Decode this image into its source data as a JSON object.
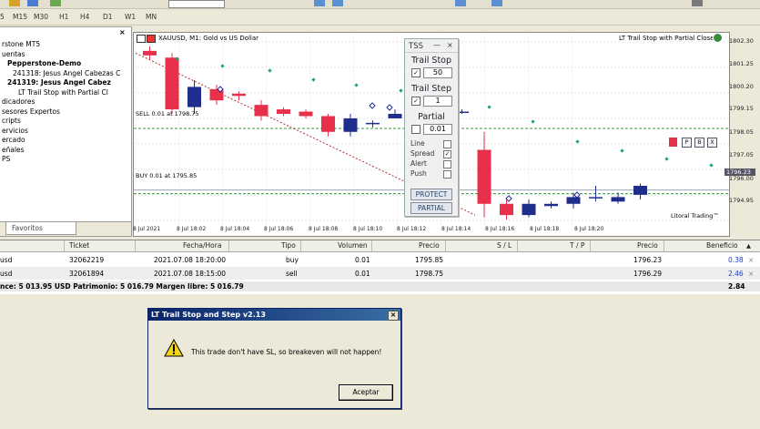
{
  "timeframes": [
    "5",
    "M15",
    "M30",
    "H1",
    "H4",
    "D1",
    "W1",
    "MN"
  ],
  "navigator": {
    "rows": [
      {
        "label": "rstone MT5",
        "bold": false
      },
      {
        "label": "uentas",
        "bold": false
      },
      {
        "label": "Pepperstone-Demo",
        "bold": true
      },
      {
        "label": "241318: Jesus Angel Cabezas C",
        "bold": false
      },
      {
        "label": "241319: Jesus Angel Cabez",
        "bold": true
      },
      {
        "label": "LT Trail Stop with Partial Cl",
        "bold": false
      },
      {
        "label": "dicadores",
        "bold": false
      },
      {
        "label": "sesores Expertos",
        "bold": false
      },
      {
        "label": "cripts",
        "bold": false
      },
      {
        "label": "ervicios",
        "bold": false
      },
      {
        "label": "ercado",
        "bold": false
      },
      {
        "label": "eñales",
        "bold": false
      },
      {
        "label": "PS",
        "bold": false
      }
    ],
    "close": "×",
    "favorites_tab": "Favoritos"
  },
  "chart": {
    "symbol_title": "XAUUSD, M1:  Gold vs US Dollar",
    "ea_title": "LT Trail Stop with Partial Close",
    "sell_line_label": "SELL 0.01 at 1798.75",
    "buy_line_label": "BUY 0.01 at 1795.85",
    "current_price": "1796.23",
    "watermark": "Litoral Trading™",
    "price_labels": [
      "1802.30",
      "1801.25",
      "1800.20",
      "1799.15",
      "1798.05",
      "1797.05",
      "1796.00",
      "1794.95"
    ],
    "time_labels": [
      "8 Jul 2021",
      "8 Jul 18:02",
      "8 Jul 18:04",
      "8 Jul 18:06",
      "8 Jul 18:08",
      "8 Jul 18:10",
      "8 Jul 18:12",
      "8 Jul 18:14",
      "8 Jul 18:16",
      "8 Jul 18:18",
      "8 Jul 18:20"
    ],
    "pbx": [
      "P",
      "B",
      "X"
    ]
  },
  "tss": {
    "title": "TSS",
    "minimize": "—",
    "close": "×",
    "trail_stop_label": "Trail Stop",
    "trail_stop_value": "50",
    "trail_step_label": "Trail Step",
    "trail_step_value": "1",
    "partial_label": "Partial",
    "partial_value": "0.01",
    "check": "✓",
    "opts": [
      {
        "label": "Line",
        "checked": false
      },
      {
        "label": "Spread",
        "checked": true
      },
      {
        "label": "Alert",
        "checked": false
      },
      {
        "label": "Push",
        "checked": false
      }
    ],
    "protect_btn": "PROTECT",
    "partial_btn": "PARTIAL"
  },
  "table": {
    "headers": [
      "Ticket",
      "Fecha/Hora",
      "Tipo",
      "Volumen",
      "Precio",
      "S / L",
      "T / P",
      "Precio",
      "Beneficio"
    ],
    "rows": [
      {
        "symbol": "usd",
        "ticket": "32062219",
        "time": "2021.07.08 18:20:00",
        "type": "buy",
        "volume": "0.01",
        "price": "1795.85",
        "sl": "",
        "tp": "",
        "cur": "1796.23",
        "profit": "0.38"
      },
      {
        "symbol": "usd",
        "ticket": "32061894",
        "time": "2021.07.08 18:15:00",
        "type": "sell",
        "volume": "0.01",
        "price": "1798.75",
        "sl": "",
        "tp": "",
        "cur": "1796.29",
        "profit": "2.46"
      }
    ],
    "balance_line": "nce: 5 013.95 USD  Patrimonio: 5 016.79  Margen libre: 5 016.79",
    "total_profit": "2.84",
    "close_x": "×"
  },
  "dialog": {
    "title": "LT Trail Stop and Step v2.13",
    "message": "This trade don't have SL, so breakeven will not happen!",
    "ok": "Aceptar",
    "close": "×"
  },
  "colors": {
    "bull": "#1f2e8c",
    "bear": "#e8304a",
    "green_dots": "#1aa36b",
    "sell_line": "#3a9a3a",
    "buy_line": "#3a9a3a"
  },
  "chart_data": {
    "type": "candlestick",
    "price_min": 1794.5,
    "price_max": 1802.6,
    "candles": [
      {
        "o": 1802.2,
        "h": 1802.4,
        "c": 1802.0,
        "l": 1801.8
      },
      {
        "o": 1801.9,
        "h": 1802.1,
        "c": 1799.6,
        "l": 1799.4
      },
      {
        "o": 1799.7,
        "h": 1800.9,
        "c": 1800.6,
        "l": 1799.4
      },
      {
        "o": 1800.5,
        "h": 1800.7,
        "c": 1800.0,
        "l": 1799.8
      },
      {
        "o": 1800.3,
        "h": 1800.4,
        "c": 1800.2,
        "l": 1800.0
      },
      {
        "o": 1799.8,
        "h": 1800.0,
        "c": 1799.3,
        "l": 1799.1
      },
      {
        "o": 1799.6,
        "h": 1799.7,
        "c": 1799.4,
        "l": 1799.3
      },
      {
        "o": 1799.5,
        "h": 1799.6,
        "c": 1799.3,
        "l": 1799.2
      },
      {
        "o": 1799.3,
        "h": 1799.4,
        "c": 1798.6,
        "l": 1798.4
      },
      {
        "o": 1798.6,
        "h": 1799.4,
        "c": 1799.2,
        "l": 1798.4
      },
      {
        "o": 1799.0,
        "h": 1799.1,
        "c": 1799.0,
        "l": 1798.8
      },
      {
        "o": 1799.2,
        "h": 1799.6,
        "c": 1799.4,
        "l": 1799.2
      },
      {
        "o": 1799.0,
        "h": 1799.4,
        "c": 1799.5,
        "l": 1798.8
      },
      {
        "o": 1799.6,
        "h": 1799.7,
        "c": 1799.5,
        "l": 1799.3
      },
      {
        "o": 1799.5,
        "h": 1799.6,
        "c": 1799.5,
        "l": 1799.4
      },
      {
        "o": 1797.8,
        "h": 1798.6,
        "c": 1795.4,
        "l": 1794.8
      },
      {
        "o": 1795.4,
        "h": 1795.6,
        "c": 1794.9,
        "l": 1794.7
      },
      {
        "o": 1794.9,
        "h": 1795.6,
        "c": 1795.4,
        "l": 1794.8
      },
      {
        "o": 1795.3,
        "h": 1795.5,
        "c": 1795.4,
        "l": 1795.2
      },
      {
        "o": 1795.4,
        "h": 1795.9,
        "c": 1795.7,
        "l": 1795.2
      },
      {
        "o": 1795.7,
        "h": 1796.2,
        "c": 1795.7,
        "l": 1795.5
      },
      {
        "o": 1795.5,
        "h": 1795.9,
        "c": 1795.7,
        "l": 1795.4
      },
      {
        "o": 1795.8,
        "h": 1796.3,
        "c": 1796.2,
        "l": 1795.6
      }
    ],
    "sell_entry": 1798.75,
    "buy_entry": 1795.85
  }
}
